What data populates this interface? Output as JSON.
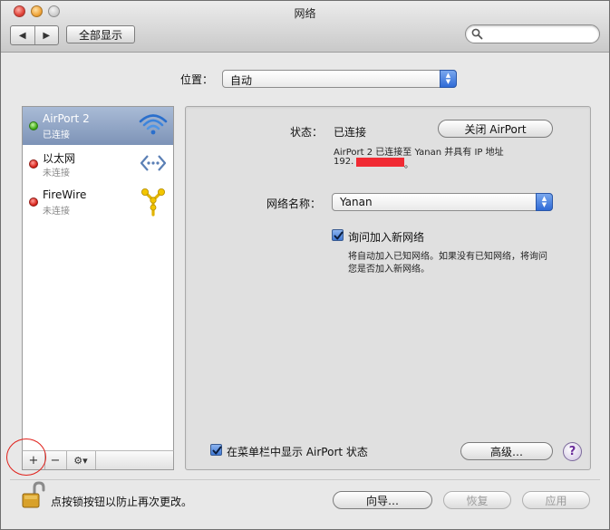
{
  "window": {
    "title": "网络"
  },
  "toolbar": {
    "back_glyph": "◀",
    "forward_glyph": "▶",
    "show_all": "全部显示",
    "search_placeholder": ""
  },
  "location": {
    "label": "位置：",
    "value": "自动"
  },
  "services": [
    {
      "name": "AirPort 2",
      "status": "已连接",
      "dot": "green",
      "icon": "wifi-icon",
      "selected": true
    },
    {
      "name": "以太网",
      "status": "未连接",
      "dot": "red",
      "icon": "ethernet-icon",
      "selected": false
    },
    {
      "name": "FireWire",
      "status": "未连接",
      "dot": "red",
      "icon": "firewire-icon",
      "selected": false
    }
  ],
  "sidebar_buttons": {
    "add": "+",
    "remove": "−",
    "gear_glyph": "⚙▾"
  },
  "detail": {
    "status_label": "状态：",
    "status_value": "已连接",
    "turn_off_button": "关闭 AirPort",
    "status_desc_line1": "AirPort 2 已连接至 Yanan 并具有 IP 地址",
    "ip_prefix": "192.",
    "ip_suffix": "。",
    "network_name_label": "网络名称：",
    "network_name_value": "Yanan",
    "ask_join_label": "询问加入新网络",
    "ask_join_checked": true,
    "ask_join_desc_line1": "将自动加入已知网络。如果没有已知网络，将询问",
    "ask_join_desc_line2": "您是否加入新网络。",
    "menubar_label": "在菜单栏中显示 AirPort 状态",
    "menubar_checked": true,
    "advanced_button": "高级…",
    "help_glyph": "?"
  },
  "footer": {
    "lock_text": "点按锁按钮以防止再次更改。",
    "assistant_button": "向导…",
    "revert_button": "恢复",
    "apply_button": "应用"
  },
  "colors": {
    "selected_row": "#8da1c2",
    "accent_blue": "#2f6ad6",
    "redaction": "#f02a33",
    "annotation_circle": "#e0201a"
  }
}
